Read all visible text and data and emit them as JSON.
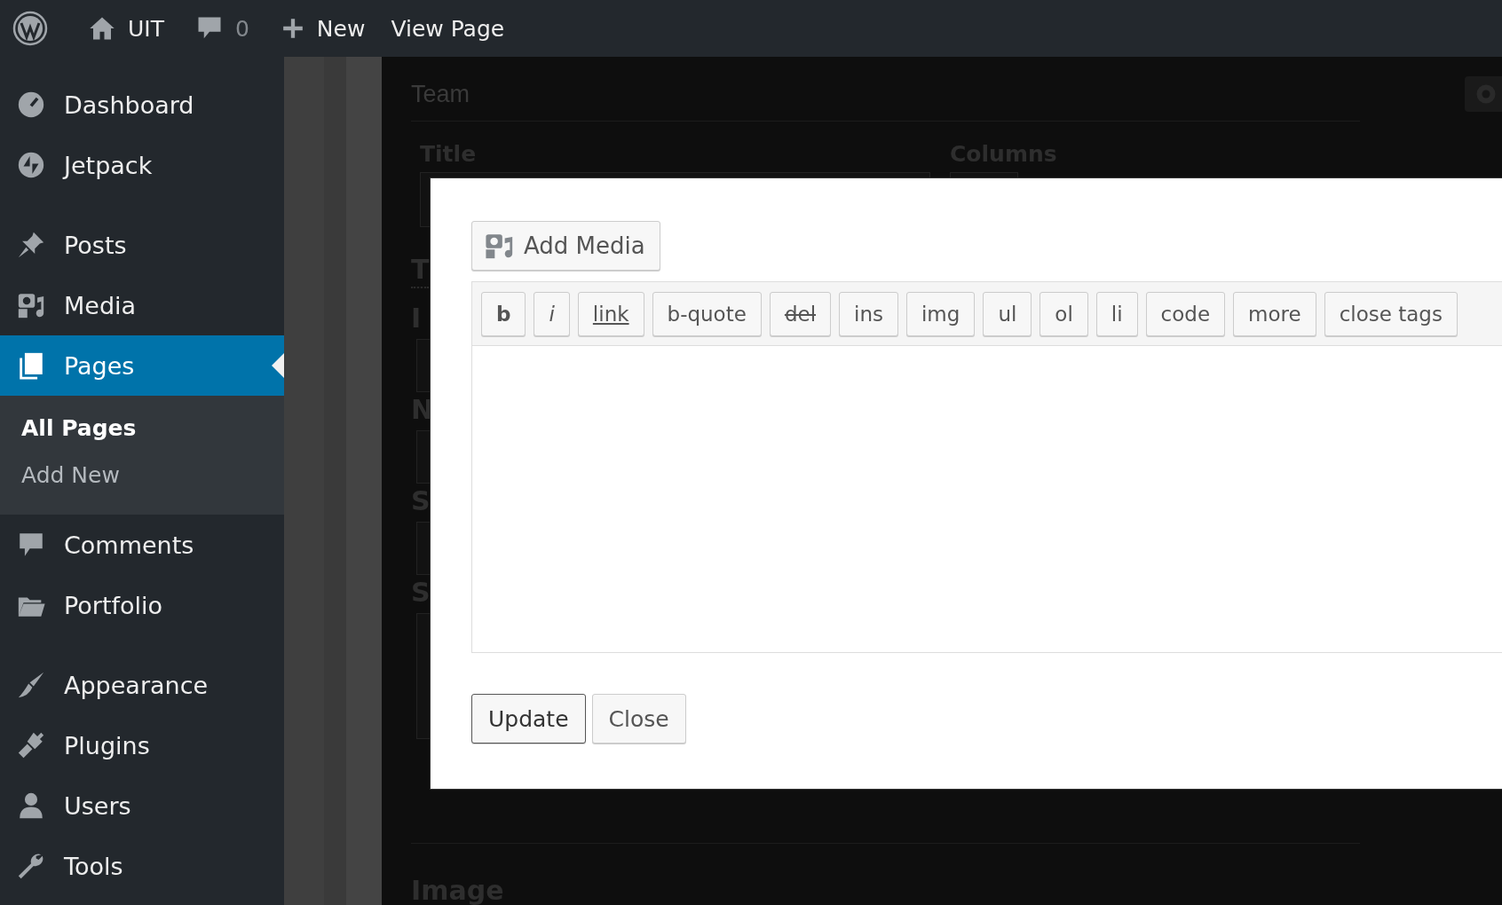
{
  "admin_bar": {
    "site_name": "UIT",
    "comments_count": "0",
    "new_label": "New",
    "view_label": "View Page"
  },
  "sidebar": {
    "groups": [
      {
        "items": [
          {
            "label": "Dashboard",
            "selected": false
          },
          {
            "label": "Jetpack",
            "selected": false
          }
        ]
      },
      {
        "items": [
          {
            "label": "Posts",
            "selected": false
          },
          {
            "label": "Media",
            "selected": false
          },
          {
            "label": "Pages",
            "selected": true,
            "children": [
              {
                "label": "All Pages",
                "selected": true
              },
              {
                "label": "Add New",
                "selected": false
              }
            ]
          },
          {
            "label": "Comments",
            "selected": false
          },
          {
            "label": "Portfolio",
            "selected": false
          }
        ]
      },
      {
        "items": [
          {
            "label": "Appearance",
            "selected": false
          },
          {
            "label": "Plugins",
            "selected": false
          },
          {
            "label": "Users",
            "selected": false
          },
          {
            "label": "Tools",
            "selected": false
          }
        ]
      }
    ]
  },
  "background": {
    "title": "Team",
    "field_labels": [
      "Title",
      "Columns"
    ],
    "cut_labels": [
      "T",
      "I",
      "N",
      "S",
      "S"
    ],
    "section": "Image"
  },
  "modal": {
    "add_media": "Add Media",
    "quicktags": [
      {
        "label": "b",
        "kind": "bold"
      },
      {
        "label": "i",
        "kind": "italic"
      },
      {
        "label": "link",
        "kind": "link"
      },
      {
        "label": "b-quote",
        "kind": "plain"
      },
      {
        "label": "del",
        "kind": "strike"
      },
      {
        "label": "ins",
        "kind": "plain"
      },
      {
        "label": "img",
        "kind": "plain"
      },
      {
        "label": "ul",
        "kind": "plain"
      },
      {
        "label": "ol",
        "kind": "plain"
      },
      {
        "label": "li",
        "kind": "plain"
      },
      {
        "label": "code",
        "kind": "plain"
      },
      {
        "label": "more",
        "kind": "plain"
      },
      {
        "label": "close tags",
        "kind": "plain"
      }
    ],
    "buttons": [
      {
        "label": "Update",
        "kind": "primary"
      },
      {
        "label": "Close",
        "kind": "secondary"
      }
    ]
  }
}
